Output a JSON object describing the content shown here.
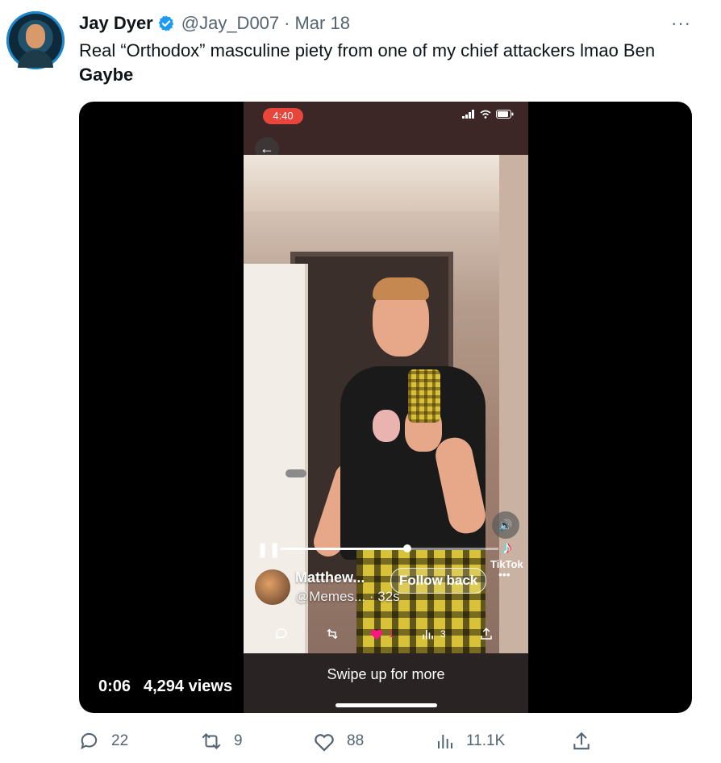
{
  "tweet": {
    "author_name": "Jay Dyer",
    "handle": "@Jay_D007",
    "separator": "·",
    "date": "Mar 18",
    "more": "···",
    "text_main": "Real “Orthodox” masculine piety from one of my chief attackers lmao Ben ",
    "text_bold": "Gaybe"
  },
  "video": {
    "elapsed": "0:06",
    "views": "4,294 views",
    "phone": {
      "status_time": "4:40",
      "back_icon": "←",
      "volume_icon": "🔊",
      "pause_icon": "❚❚",
      "progress_fraction": 0.58,
      "tiktok_label": "TikTok",
      "tiktok_note": "♪",
      "user_name": "Matthew...",
      "user_handle": "@Memes... · 32s",
      "follow_back": "Follow back",
      "more": "•••",
      "like_count": "1",
      "views_count": "3",
      "swipe_text": "Swipe up for more"
    }
  },
  "actions": {
    "replies": "22",
    "retweets": "9",
    "likes": "88",
    "views": "11.1K"
  },
  "colors": {
    "verified": "#1d9bf0",
    "muted": "#536471",
    "like_pink": "#f91880"
  }
}
